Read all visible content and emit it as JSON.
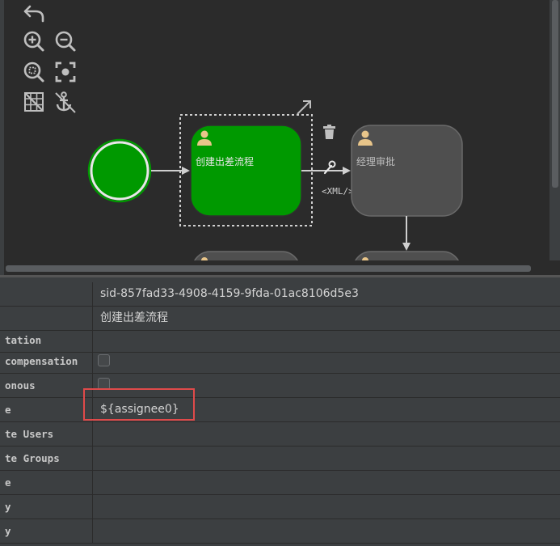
{
  "toolbar": {
    "undo": "undo-icon",
    "zoom_in": "zoom-in-icon",
    "zoom_out": "zoom-out-icon",
    "zoom_fit": "zoom-fit-icon",
    "zoom_actual": "zoom-actual-icon",
    "grid": "grid-icon",
    "anchor": "anchor-icon"
  },
  "diagram": {
    "start_event": {
      "icon": "start-event-circle"
    },
    "tasks": [
      {
        "label": "创建出差流程",
        "icon": "user-icon",
        "selected": true,
        "color": "#009900"
      },
      {
        "label": "经理审批",
        "icon": "user-icon",
        "selected": false,
        "color": "#4f4f4f"
      }
    ],
    "hover_tools": {
      "resize": "resize-arrow-icon",
      "delete": "trash-icon",
      "wrench": "wrench-icon",
      "xml_label": "<XML/>"
    }
  },
  "properties": {
    "rows": [
      {
        "name": "",
        "value": "sid-857fad33-4908-4159-9fda-01ac8106d5e3"
      },
      {
        "name": "",
        "value": "创建出差流程"
      },
      {
        "name": "tation",
        "value": ""
      },
      {
        "name": "compensation",
        "checkbox": true
      },
      {
        "name": "onous",
        "checkbox": true
      },
      {
        "name": "e",
        "value": "${assignee0}"
      },
      {
        "name": "te Users",
        "value": ""
      },
      {
        "name": "te Groups",
        "value": ""
      },
      {
        "name": "e",
        "value": ""
      },
      {
        "name": "y",
        "value": ""
      },
      {
        "name": "y",
        "value": ""
      }
    ]
  },
  "colors": {
    "accent_green": "#009900",
    "highlight_red": "#e04a4a",
    "user_icon": "#e8c58a"
  }
}
